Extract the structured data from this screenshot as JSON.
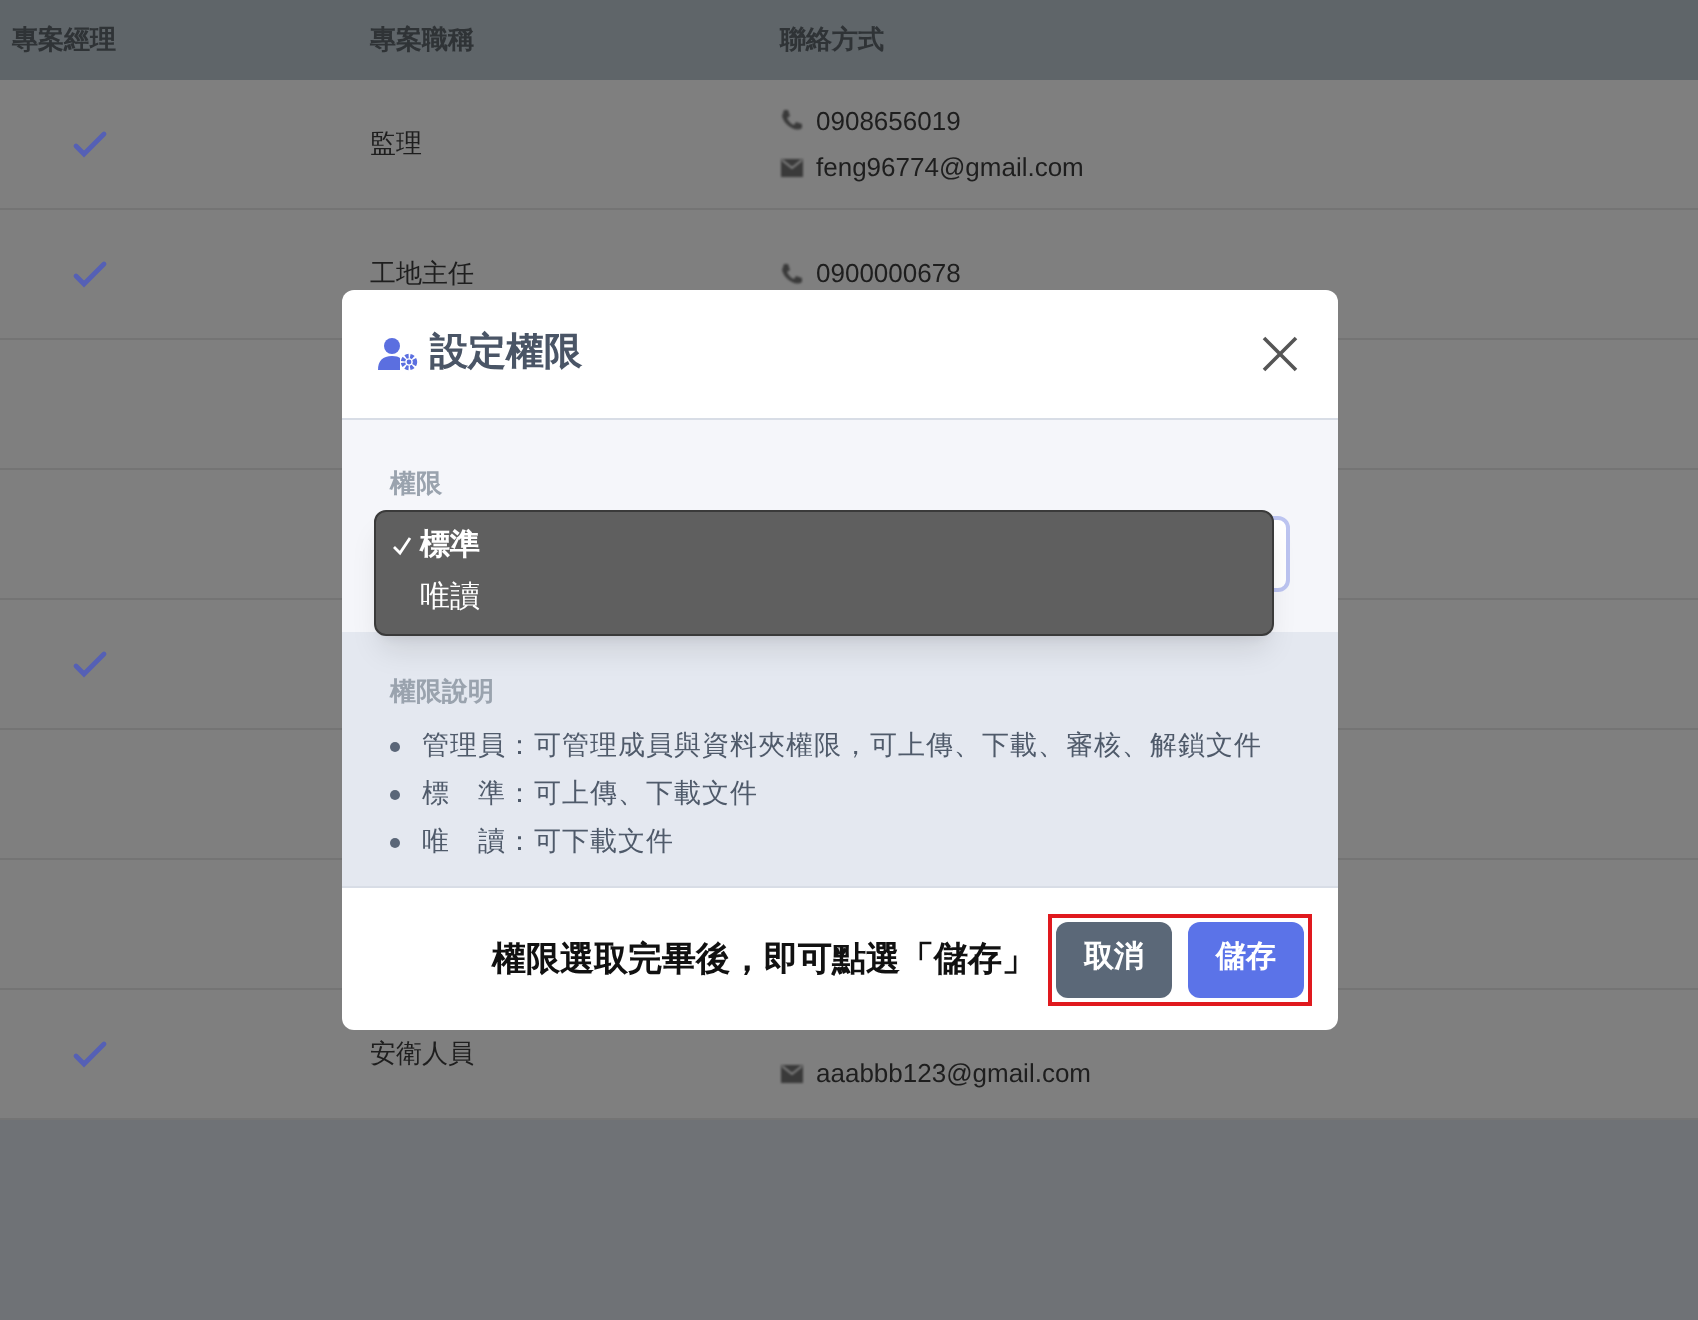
{
  "table": {
    "columns": [
      "專案經理",
      "專案職稱",
      "聯絡方式"
    ],
    "rows": [
      {
        "manager": true,
        "title": "監理",
        "phone": "0908656019",
        "email": "feng96774@gmail.com"
      },
      {
        "manager": true,
        "title": "工地主任",
        "phone": "0900000678"
      },
      {
        "manager": false
      },
      {
        "manager": false
      },
      {
        "manager": true
      },
      {
        "manager": false
      },
      {
        "manager": false
      },
      {
        "manager": true,
        "title": "安衛人員",
        "email": "aaabbb123@gmail.com"
      }
    ]
  },
  "dialog": {
    "title": "設定權限",
    "field_label": "權限",
    "options": [
      {
        "label": "標準",
        "selected": true
      },
      {
        "label": "唯讀",
        "selected": false
      }
    ],
    "description_title": "權限說明",
    "descriptions": [
      "管理員：可管理成員與資料夾權限，可上傳、下載、審核、解鎖文件",
      "標　準：可上傳、下載文件",
      "唯　讀：可下載文件"
    ],
    "annotation": "權限選取完畢後，即可點選「儲存」",
    "buttons": [
      {
        "label": "取消",
        "kind": "secondary"
      },
      {
        "label": "儲存",
        "kind": "primary"
      }
    ]
  }
}
